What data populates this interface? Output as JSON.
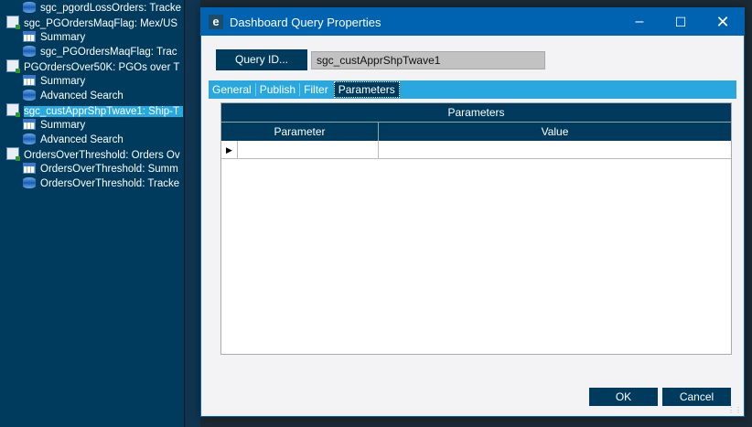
{
  "tree": {
    "items": [
      {
        "label": "sgc_pgordLossOrders: Tracke",
        "icon": "database-icon",
        "indent": 1
      },
      {
        "label": "sgc_PGOrdersMaqFlag: Mex/US",
        "icon": "query-icon",
        "indent": 0
      },
      {
        "label": "Summary",
        "icon": "table-icon",
        "indent": 1
      },
      {
        "label": "sgc_PGOrdersMaqFlag: Trac",
        "icon": "database-icon",
        "indent": 1
      },
      {
        "label": "PGOrdersOver50K: PGOs over T",
        "icon": "query-icon",
        "indent": 0
      },
      {
        "label": "Summary",
        "icon": "table-icon",
        "indent": 1
      },
      {
        "label": "Advanced Search",
        "icon": "database-icon",
        "indent": 1
      },
      {
        "label": "sgc_custApprShpTwave1: Ship-T",
        "icon": "query-icon",
        "indent": 0,
        "selected": true
      },
      {
        "label": "Summary",
        "icon": "table-icon",
        "indent": 1
      },
      {
        "label": "Advanced Search",
        "icon": "database-icon",
        "indent": 1
      },
      {
        "label": "OrdersOverThreshold: Orders Ov",
        "icon": "query-icon",
        "indent": 0
      },
      {
        "label": "OrdersOverThreshold: Summ",
        "icon": "table-icon",
        "indent": 1
      },
      {
        "label": "OrdersOverThreshold: Tracke",
        "icon": "database-icon",
        "indent": 1
      }
    ]
  },
  "dialog": {
    "title": "Dashboard Query Properties",
    "logo": "e",
    "query_id_button": "Query ID...",
    "query_id_value": "sgc_custApprShpTwave1",
    "tabs": [
      "General",
      "Publish",
      "Filter",
      "Parameters"
    ],
    "active_tab": "Parameters",
    "grid": {
      "title": "Parameters",
      "columns": [
        "Parameter",
        "Value"
      ]
    },
    "ok": "OK",
    "cancel": "Cancel"
  }
}
